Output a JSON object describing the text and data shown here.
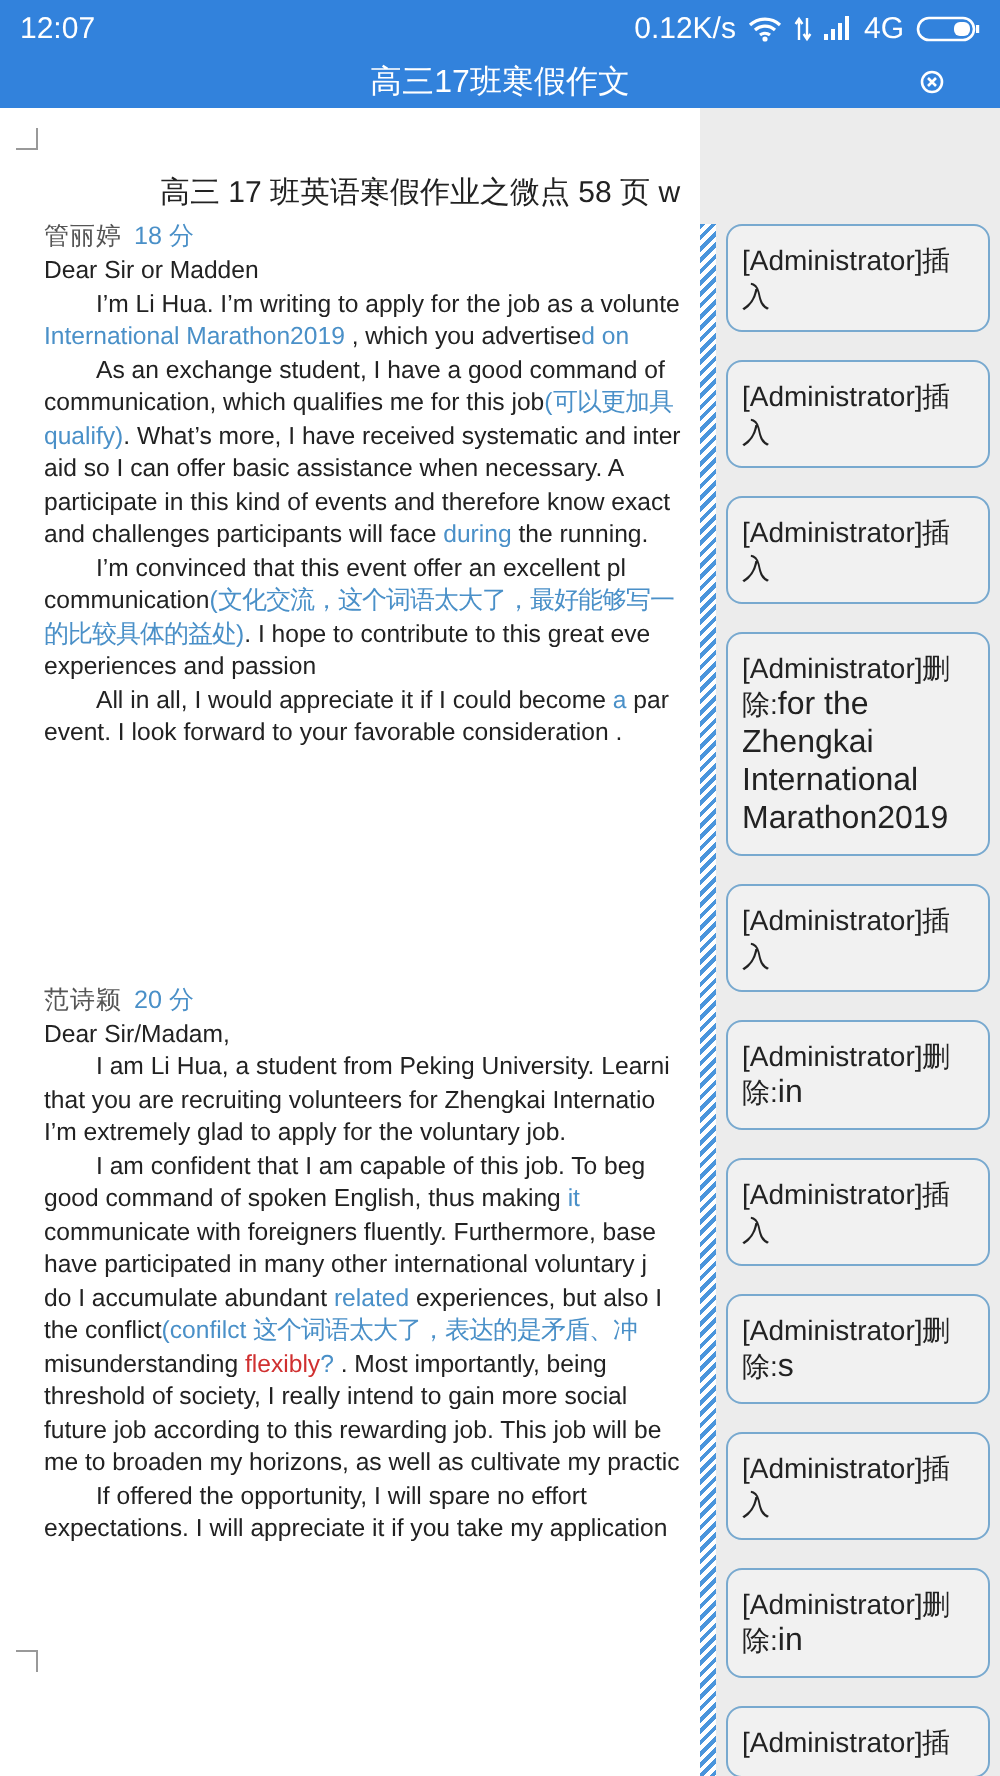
{
  "status_bar": {
    "time": "12:07",
    "speed": "0.12K/s",
    "network": "4G"
  },
  "app_bar": {
    "title": "高三17班寒假作文"
  },
  "document": {
    "title": "高三 17 班英语寒假作业之微点 58 页 w",
    "essays": [
      {
        "author": "管丽婷",
        "score": "18 分",
        "lines": [
          {
            "indent": false,
            "segments": [
              {
                "kind": "normal",
                "text": "Dear Sir or Madden"
              }
            ]
          },
          {
            "indent": true,
            "segments": [
              {
                "kind": "normal",
                "text": "I’m Li Hua. I’m writing to apply for the job as a volunte"
              }
            ]
          },
          {
            "indent": false,
            "segments": [
              {
                "kind": "insert",
                "text": "International Marathon2019"
              },
              {
                "kind": "normal",
                "text": "  , which you advertise"
              },
              {
                "kind": "insert",
                "text": "d  on"
              }
            ]
          },
          {
            "indent": true,
            "segments": [
              {
                "kind": "normal",
                "text": "As an exchange student, I have a good command of"
              }
            ]
          },
          {
            "indent": false,
            "segments": [
              {
                "kind": "normal",
                "text": "communication, which qualifies me for this job"
              },
              {
                "kind": "insert",
                "text": "(可以更加具"
              }
            ]
          },
          {
            "indent": false,
            "segments": [
              {
                "kind": "insert",
                "text": "qualify)"
              },
              {
                "kind": "normal",
                "text": ". What’s more, I have received systematic and inter"
              }
            ]
          },
          {
            "indent": false,
            "segments": [
              {
                "kind": "normal",
                "text": "aid so I can offer basic assistance when necessary. A"
              }
            ]
          },
          {
            "indent": false,
            "segments": [
              {
                "kind": "normal",
                "text": "participate in this kind of events and therefore know exact"
              }
            ]
          },
          {
            "indent": false,
            "segments": [
              {
                "kind": "normal",
                "text": "and challenges participants will face "
              },
              {
                "kind": "insert",
                "text": "during"
              },
              {
                "kind": "normal",
                "text": " the running."
              }
            ]
          },
          {
            "indent": true,
            "segments": [
              {
                "kind": "normal",
                "text": "I’m convinced that this event offer an excellent pl"
              }
            ]
          },
          {
            "indent": false,
            "segments": [
              {
                "kind": "normal",
                "text": "communication"
              },
              {
                "kind": "insert",
                "text": "(文化交流，这个词语太大了，最好能够写一"
              }
            ]
          },
          {
            "indent": false,
            "segments": [
              {
                "kind": "insert",
                "text": "的比较具体的益处)"
              },
              {
                "kind": "normal",
                "text": ". I hope to contribute to this great eve"
              }
            ]
          },
          {
            "indent": false,
            "segments": [
              {
                "kind": "normal",
                "text": "experiences and passion"
              }
            ]
          },
          {
            "indent": true,
            "segments": [
              {
                "kind": "normal",
                "text": "All in all, I would appreciate it if I could become "
              },
              {
                "kind": "insert",
                "text": "a"
              },
              {
                "kind": "normal",
                "text": " par"
              }
            ]
          },
          {
            "indent": false,
            "segments": [
              {
                "kind": "normal",
                "text": "event. I look forward to your favorable consideration ."
              }
            ]
          }
        ]
      },
      {
        "author": "范诗颖",
        "score": "20 分",
        "lines": [
          {
            "indent": false,
            "segments": [
              {
                "kind": "normal",
                "text": "Dear Sir/Madam,"
              }
            ]
          },
          {
            "indent": true,
            "segments": [
              {
                "kind": "normal",
                "text": "I am Li Hua, a student from Peking University. Learni"
              }
            ]
          },
          {
            "indent": false,
            "segments": [
              {
                "kind": "normal",
                "text": "that you are recruiting volunteers for Zhengkai Internatio"
              }
            ]
          },
          {
            "indent": false,
            "segments": [
              {
                "kind": "normal",
                "text": "I’m extremely glad to apply for the voluntary job."
              }
            ]
          },
          {
            "indent": true,
            "segments": [
              {
                "kind": "normal",
                "text": "I am confident that I am capable of this job. To beg"
              }
            ]
          },
          {
            "indent": false,
            "segments": [
              {
                "kind": "normal",
                "text": "good command of spoken English, thus making "
              },
              {
                "kind": "insert",
                "text": "it"
              }
            ]
          },
          {
            "indent": false,
            "segments": [
              {
                "kind": "normal",
                "text": "communicate with foreigners fluently. Furthermore, base"
              }
            ]
          },
          {
            "indent": false,
            "segments": [
              {
                "kind": "normal",
                "text": "have participated in many other international voluntary j"
              }
            ]
          },
          {
            "indent": false,
            "segments": [
              {
                "kind": "normal",
                "text": "do I accumulate abundant "
              },
              {
                "kind": "insert",
                "text": "related"
              },
              {
                "kind": "normal",
                "text": " experiences, but also I"
              }
            ]
          },
          {
            "indent": false,
            "segments": [
              {
                "kind": "normal",
                "text": "the conflict"
              },
              {
                "kind": "insert",
                "text": "(confilct 这个词语太大了，表达的是矛盾、冲"
              }
            ]
          },
          {
            "indent": false,
            "segments": [
              {
                "kind": "normal",
                "text": "misunderstanding "
              },
              {
                "kind": "error",
                "text": "flexibly"
              },
              {
                "kind": "insert",
                "text": "?"
              },
              {
                "kind": "normal",
                "text": " . Most importantly,  being"
              }
            ]
          },
          {
            "indent": false,
            "segments": [
              {
                "kind": "normal",
                "text": "threshold of society, I really intend to gain more social"
              }
            ]
          },
          {
            "indent": false,
            "segments": [
              {
                "kind": "normal",
                "text": "future job according to this rewarding job. This job will be"
              }
            ]
          },
          {
            "indent": false,
            "segments": [
              {
                "kind": "normal",
                "text": "me to broaden my horizons, as well as cultivate my practic"
              }
            ]
          },
          {
            "indent": true,
            "segments": [
              {
                "kind": "normal",
                "text": "If offered the opportunity, I will spare no effort"
              }
            ]
          },
          {
            "indent": false,
            "segments": [
              {
                "kind": "normal",
                "text": "expectations. I will appreciate it if you take my application"
              }
            ]
          }
        ]
      }
    ]
  },
  "comments": [
    {
      "kind": "insert",
      "label": "[Administrator]插入"
    },
    {
      "kind": "insert",
      "label": "[Administrator]插入"
    },
    {
      "kind": "insert",
      "label": "[Administrator]插入"
    },
    {
      "kind": "delete",
      "label": "[Administrator]删除:",
      "deleted": "for the Zhengkai International Marathon2019"
    },
    {
      "kind": "insert",
      "label": "[Administrator]插入"
    },
    {
      "kind": "delete",
      "label": "[Administrator]删除:",
      "deleted": "in"
    },
    {
      "kind": "insert",
      "label": "[Administrator]插入"
    },
    {
      "kind": "delete",
      "label": "[Administrator]删除:",
      "deleted": "s"
    },
    {
      "kind": "insert",
      "label": "[Administrator]插入"
    },
    {
      "kind": "delete",
      "label": "[Administrator]删除:",
      "deleted": "in"
    },
    {
      "kind": "insert",
      "label": "[Administrator]插"
    }
  ]
}
